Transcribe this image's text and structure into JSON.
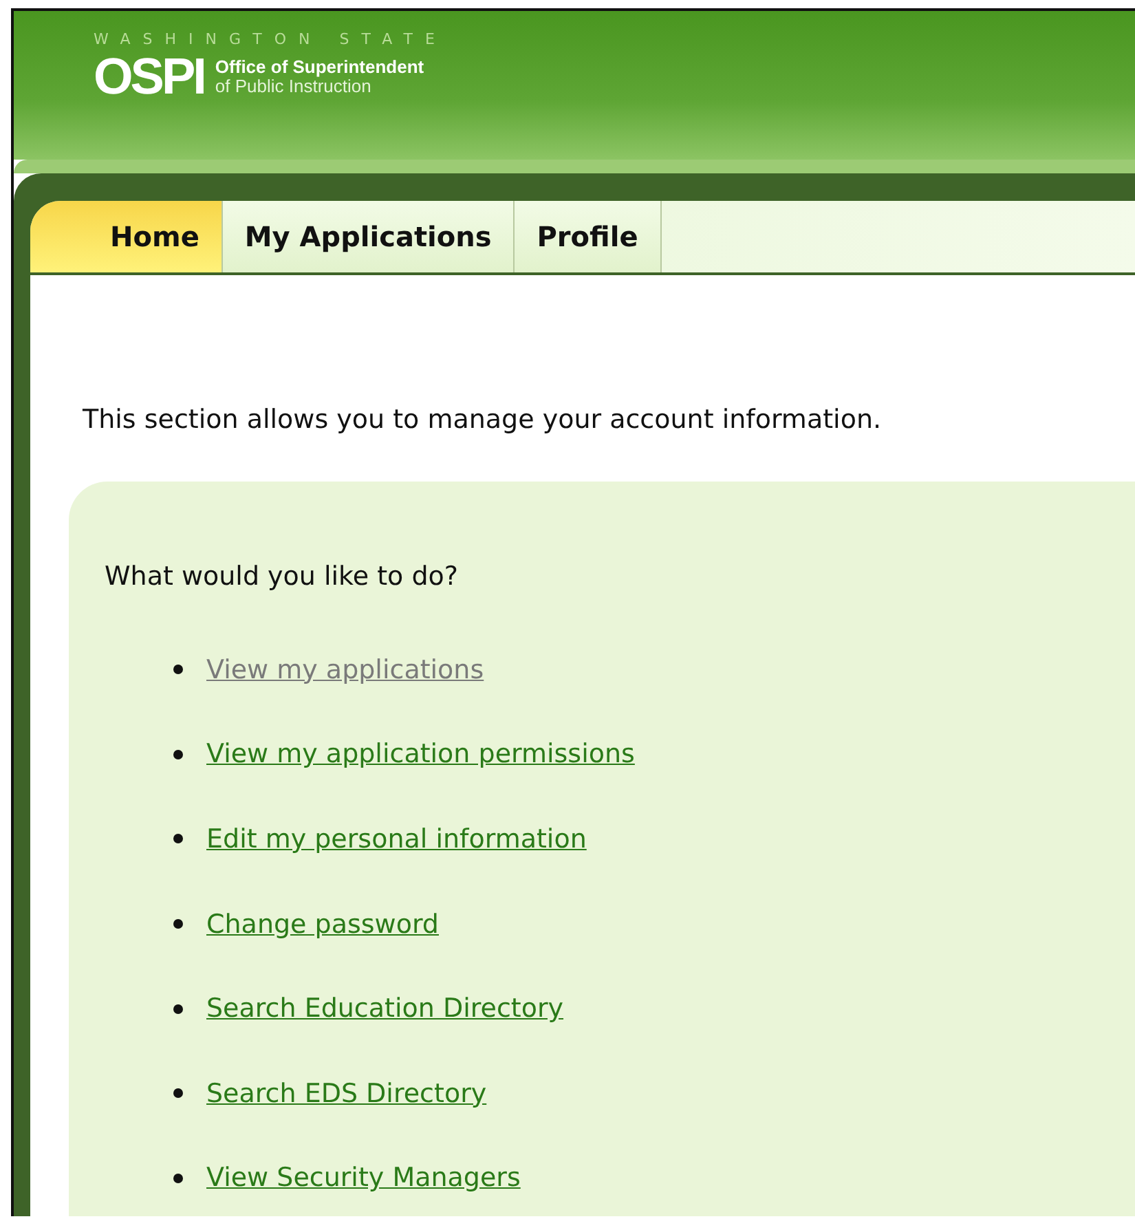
{
  "header": {
    "state": "WASHINGTON STATE",
    "logo": "OSPI",
    "org_line_1": "Office of Superintendent",
    "org_line_2": "of Public Instruction"
  },
  "tabs": [
    {
      "label": "Home",
      "selected": true
    },
    {
      "label": "My Applications",
      "selected": false
    },
    {
      "label": "Profile",
      "selected": false
    }
  ],
  "intro": "This section allows you to manage your account information.",
  "panel": {
    "question": "What would you like to do?",
    "links": [
      {
        "label": "View my applications",
        "visited": true
      },
      {
        "label": "View my application permissions",
        "visited": false
      },
      {
        "label": "Edit my personal information",
        "visited": false
      },
      {
        "label": "Change password",
        "visited": false
      },
      {
        "label": "Search Education Directory",
        "visited": false
      },
      {
        "label": "Search EDS Directory",
        "visited": false
      },
      {
        "label": "View Security Managers",
        "visited": false
      }
    ]
  }
}
